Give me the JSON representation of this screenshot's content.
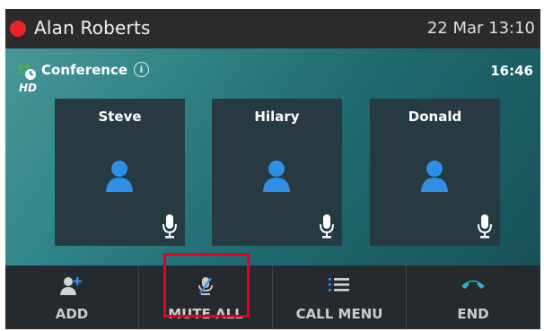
{
  "header": {
    "user_name": "Alan Roberts",
    "date_time": "22 Mar 13:10",
    "status_color": "#e8232b"
  },
  "call": {
    "label": "Conference",
    "info_glyph": "i",
    "hd_badge": "HD",
    "timer": "16:46"
  },
  "participants": [
    {
      "name": "Steve",
      "muted": false
    },
    {
      "name": "Hilary",
      "muted": false
    },
    {
      "name": "Donald",
      "muted": false
    }
  ],
  "softkeys": [
    {
      "label": "ADD",
      "icon": "add-participant-icon"
    },
    {
      "label": "MUTE ALL",
      "icon": "mute-microphone-icon",
      "highlighted": true
    },
    {
      "label": "CALL MENU",
      "icon": "menu-list-icon"
    },
    {
      "label": "END",
      "icon": "end-call-icon"
    }
  ],
  "colors": {
    "accent_blue": "#2f8fe6",
    "end_call": "#2bb3c6",
    "conference_green": "#49b04a",
    "highlight_red": "#e8001c"
  }
}
